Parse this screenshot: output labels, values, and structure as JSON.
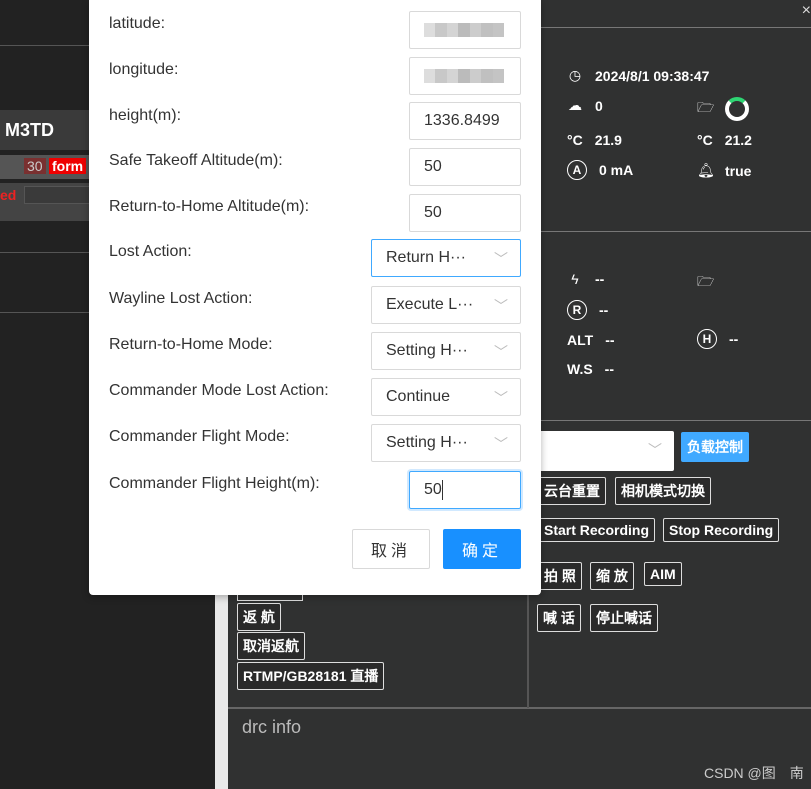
{
  "left_panel": {
    "device_name": "M3TD",
    "badge": "30",
    "badge_label": "form",
    "status_text": "ed"
  },
  "right_panel": {
    "datetime": "2024/8/1 09:38:47",
    "upload": "0",
    "temp_1": "21.9",
    "temp_2": "21.2",
    "temp_unit": "°C",
    "current": "0 mA",
    "alert_value": "true",
    "power": "--",
    "rtk": "--",
    "alt_label": "ALT",
    "alt": "--",
    "home_dist": "--",
    "ws_label": "W.S",
    "ws": "--",
    "icon_a": "A",
    "icon_r": "R",
    "icon_h": "H",
    "accent": "#2ed573"
  },
  "controls": {
    "payload_control": "负载控制",
    "left_buttons": [
      "返 航",
      "取消返航",
      "RTMP/GB28181 直播"
    ],
    "right_rows": [
      [
        "云台重置",
        "相机模式切换"
      ],
      [
        "Start Recording",
        "Stop Recording"
      ],
      [
        "拍 照",
        "缩 放",
        "AIM"
      ],
      [
        "喊 话",
        "停止喊话"
      ]
    ]
  },
  "drc": {
    "title": "drc info"
  },
  "watermark": "CSDN @图　南",
  "modal": {
    "fields": [
      {
        "label": "latitude:",
        "type": "text",
        "value": ""
      },
      {
        "label": "longitude:",
        "type": "text",
        "value": ""
      },
      {
        "label": "height(m):",
        "type": "text",
        "value": "1336.8499"
      },
      {
        "label": "Safe Takeoff Altitude(m):",
        "type": "text",
        "value": "50"
      },
      {
        "label": "Return-to-Home Altitude(m):",
        "type": "text",
        "value": "50"
      },
      {
        "label": "Lost Action:",
        "type": "select",
        "value": "Return H···"
      },
      {
        "label": "Wayline Lost Action:",
        "type": "select",
        "value": "Execute L···"
      },
      {
        "label": "Return-to-Home Mode:",
        "type": "select",
        "value": "Setting H···"
      },
      {
        "label": "Commander Mode Lost Action:",
        "type": "select",
        "value": "Continue"
      },
      {
        "label": "Commander Flight Mode:",
        "type": "select",
        "value": "Setting H···"
      },
      {
        "label": "Commander Flight Height(m):",
        "type": "text",
        "value": "50"
      }
    ],
    "cancel": "取消",
    "confirm": "确定",
    "primary_color": "#1890ff"
  }
}
